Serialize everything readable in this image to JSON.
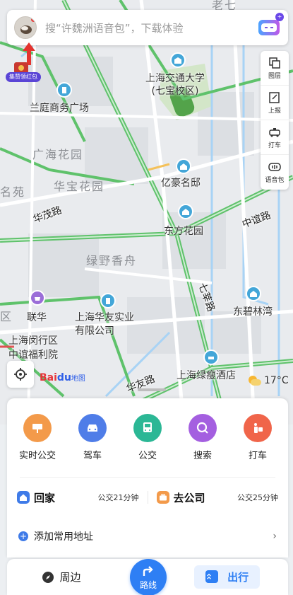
{
  "search": {
    "placeholder": "搜“许魏洲语音包”，下载体验",
    "voice_badge": "+"
  },
  "red_packet": {
    "label": "集赞领红包"
  },
  "toolbar": [
    {
      "label": "图层",
      "icon": "layers-icon"
    },
    {
      "label": "上报",
      "icon": "report-icon"
    },
    {
      "label": "打车",
      "icon": "taxi-icon"
    },
    {
      "label": "语音包",
      "icon": "voice-pack-icon"
    }
  ],
  "map": {
    "pois": [
      {
        "name": "上海交通大学\n(七宝校区)"
      },
      {
        "name": "兰庭商务广场"
      },
      {
        "name": "亿豪名邸"
      },
      {
        "name": "东方花园"
      },
      {
        "name": "联华"
      },
      {
        "name": "上海华友实业\n有限公司"
      },
      {
        "name": "东碧林湾"
      },
      {
        "name": "上海闵行区\n中谊福利院"
      },
      {
        "name": "上海绿瘦酒店"
      }
    ],
    "areas": [
      "广海花园",
      "华宝花园",
      "绿野香舟",
      "名苑"
    ],
    "roads": [
      "华茂路",
      "中谊路",
      "七莘路",
      "华友路"
    ],
    "fragments": [
      "老七",
      "区"
    ]
  },
  "logo": {
    "baidu": "Bai",
    "paw": "du",
    "ditu": "地图"
  },
  "weather": {
    "temperature": "17°C"
  },
  "quick_actions": [
    {
      "label": "实时公交",
      "color": "#f39a4a",
      "icon": "bus-stop-icon"
    },
    {
      "label": "驾车",
      "color": "#4f7de8",
      "icon": "car-icon"
    },
    {
      "label": "公交",
      "color": "#2bb795",
      "icon": "bus-icon"
    },
    {
      "label": "搜索",
      "color": "#a45fe0",
      "icon": "search-icon"
    },
    {
      "label": "打车",
      "color": "#f0654a",
      "icon": "taxi-icon"
    }
  ],
  "places": {
    "home": {
      "name": "回家",
      "eta": "公交21分钟"
    },
    "work": {
      "name": "去公司",
      "eta": "公交25分钟"
    }
  },
  "add_address": {
    "label": "添加常用地址",
    "chevron": "›"
  },
  "nav": {
    "nearby": "周边",
    "route": "路线",
    "trip": "出行"
  }
}
